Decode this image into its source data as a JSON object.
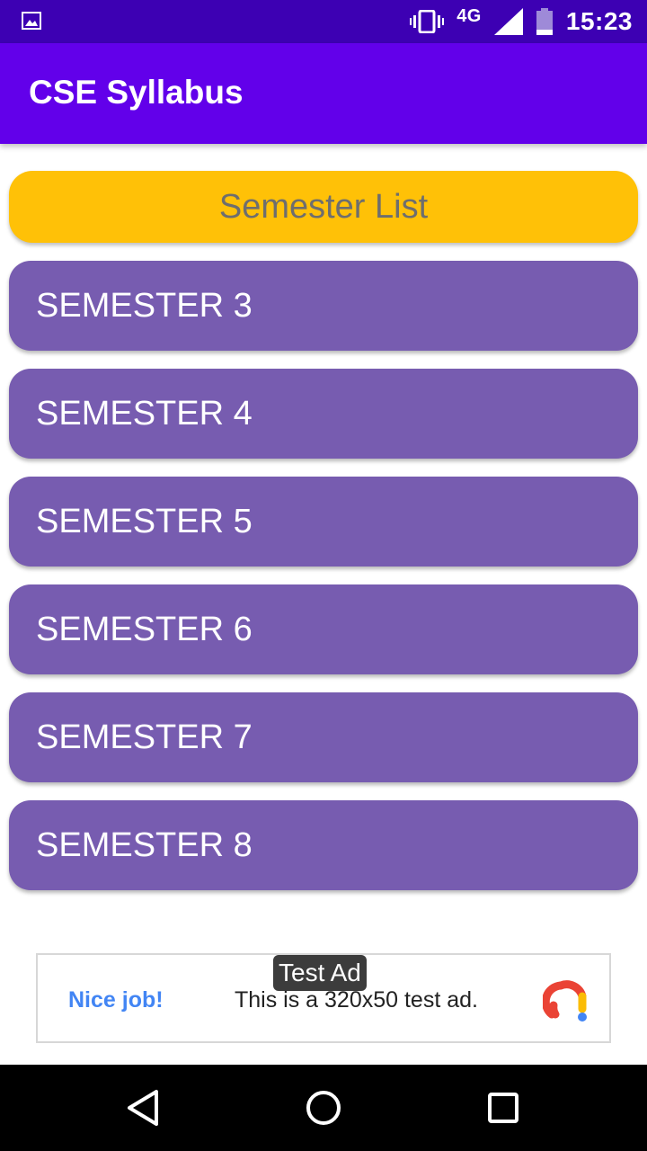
{
  "status_bar": {
    "network": "4G",
    "time": "15:23",
    "icons": [
      "image-icon",
      "vibrate-icon",
      "signal-icon",
      "battery-icon"
    ]
  },
  "app_bar": {
    "title": "CSE Syllabus"
  },
  "header_button": {
    "label": "Semester List"
  },
  "semesters": [
    {
      "label": "SEMESTER 3"
    },
    {
      "label": "SEMESTER 4"
    },
    {
      "label": "SEMESTER 5"
    },
    {
      "label": "SEMESTER 6"
    },
    {
      "label": "SEMESTER 7"
    },
    {
      "label": "SEMESTER 8"
    }
  ],
  "ad": {
    "badge": "Test Ad",
    "nice": "Nice job!",
    "text": "This is a 320x50 test ad."
  },
  "colors": {
    "status_bar": "#3d00b3",
    "app_bar": "#6200ea",
    "header_button": "#ffc107",
    "semester_button": "#775cb0",
    "nav_bar": "#000000"
  },
  "nav_bar": {
    "icons": [
      "back-icon",
      "home-icon",
      "recents-icon"
    ]
  }
}
